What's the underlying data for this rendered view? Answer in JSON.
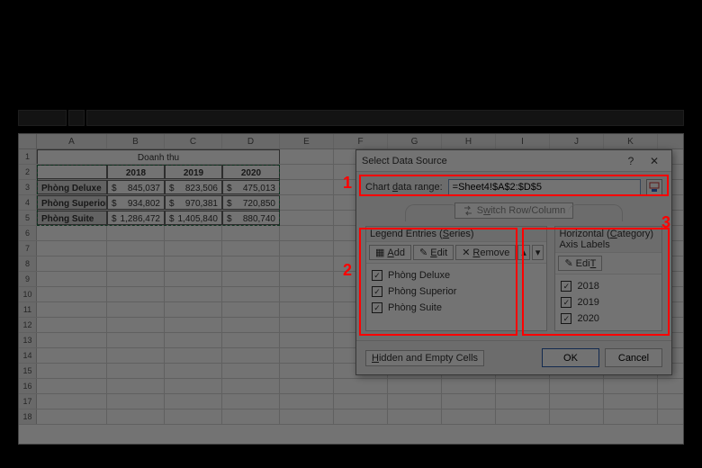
{
  "table": {
    "title": "Doanh thu",
    "years": [
      "2018",
      "2019",
      "2020"
    ],
    "rows": [
      {
        "label": "Phòng Deluxe",
        "vals": [
          "845,037",
          "823,506",
          "475,013"
        ]
      },
      {
        "label": "Phòng Superior",
        "vals": [
          "934,802",
          "970,381",
          "720,850"
        ]
      },
      {
        "label": "Phòng Suite",
        "vals": [
          "1,286,472",
          "1,405,840",
          "880,740"
        ]
      }
    ],
    "currency": "$",
    "col_letters": [
      "A",
      "B",
      "C",
      "D",
      "E",
      "F",
      "G",
      "H",
      "I",
      "J",
      "K"
    ]
  },
  "dialog": {
    "title": "Select Data Source",
    "range_label_pre": "Chart ",
    "range_label_u": "d",
    "range_label_post": "ata range:",
    "range_value": "=Sheet4!$A$2:$D$5",
    "switch_label_u": "w",
    "switch_label_pre": "S",
    "switch_label_post": "itch Row/Column",
    "legend_title_pre": "Legend Entries (",
    "legend_title_u": "S",
    "legend_title_post": "eries)",
    "axis_title_pre": "Horizontal (",
    "axis_title_u": "C",
    "axis_title_post": "ategory) Axis Labels",
    "add_u": "A",
    "add_post": "dd",
    "edit_u": "E",
    "edit_post": "dit",
    "edit2_u": "T",
    "edit2_pre": "Edi",
    "remove_u": "R",
    "remove_post": "emove",
    "series": [
      "Phòng Deluxe",
      "Phòng Superior",
      "Phòng Suite"
    ],
    "categories": [
      "2018",
      "2019",
      "2020"
    ],
    "hidden_label_u": "H",
    "hidden_label_post": "idden and Empty Cells",
    "ok": "OK",
    "cancel": "Cancel"
  },
  "callouts": {
    "n1": "1",
    "n2": "2",
    "n3": "3"
  }
}
